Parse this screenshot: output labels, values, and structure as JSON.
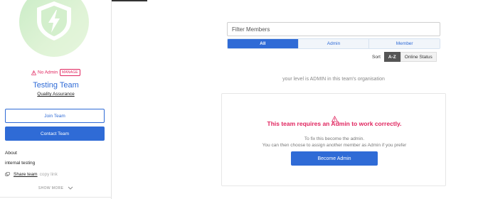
{
  "team": {
    "warning": "No Admin",
    "manage": "MANAGE",
    "name": "Testing Team",
    "subtitle": "Quality Assurance",
    "join": "Join Team",
    "contact": "Contact Team",
    "about_heading": "About",
    "about_text": "internal testing",
    "share": "Share team",
    "copy": "copy link",
    "show_more": "SHOW MORE"
  },
  "members": {
    "filter_placeholder": "Filter Members",
    "tabs": [
      {
        "label": "All",
        "active": true
      },
      {
        "label": "Admin",
        "active": false
      },
      {
        "label": "Member",
        "active": false
      }
    ],
    "sort_label": "Sort",
    "sort_options": [
      {
        "label": "A-Z",
        "active": true
      },
      {
        "label": "Online Status",
        "active": false
      }
    ],
    "level_text": "your level is ADMIN in this team's organisation"
  },
  "notice": {
    "title": "This team requires an Admin to work correctly.",
    "line1": "To fix this become the admin.",
    "line2": "You can then choose to assign another member as Admin if you prefer",
    "button": "Become Admin"
  },
  "colors": {
    "accent": "#2f6bd6",
    "danger": "#e0245e",
    "avatar_bg": "#d9f1d2"
  },
  "icons": {
    "avatar": "shield-lightning-icon",
    "warning": "warning-triangle-icon",
    "share": "share-icon",
    "chevron": "chevron-down-icon"
  }
}
